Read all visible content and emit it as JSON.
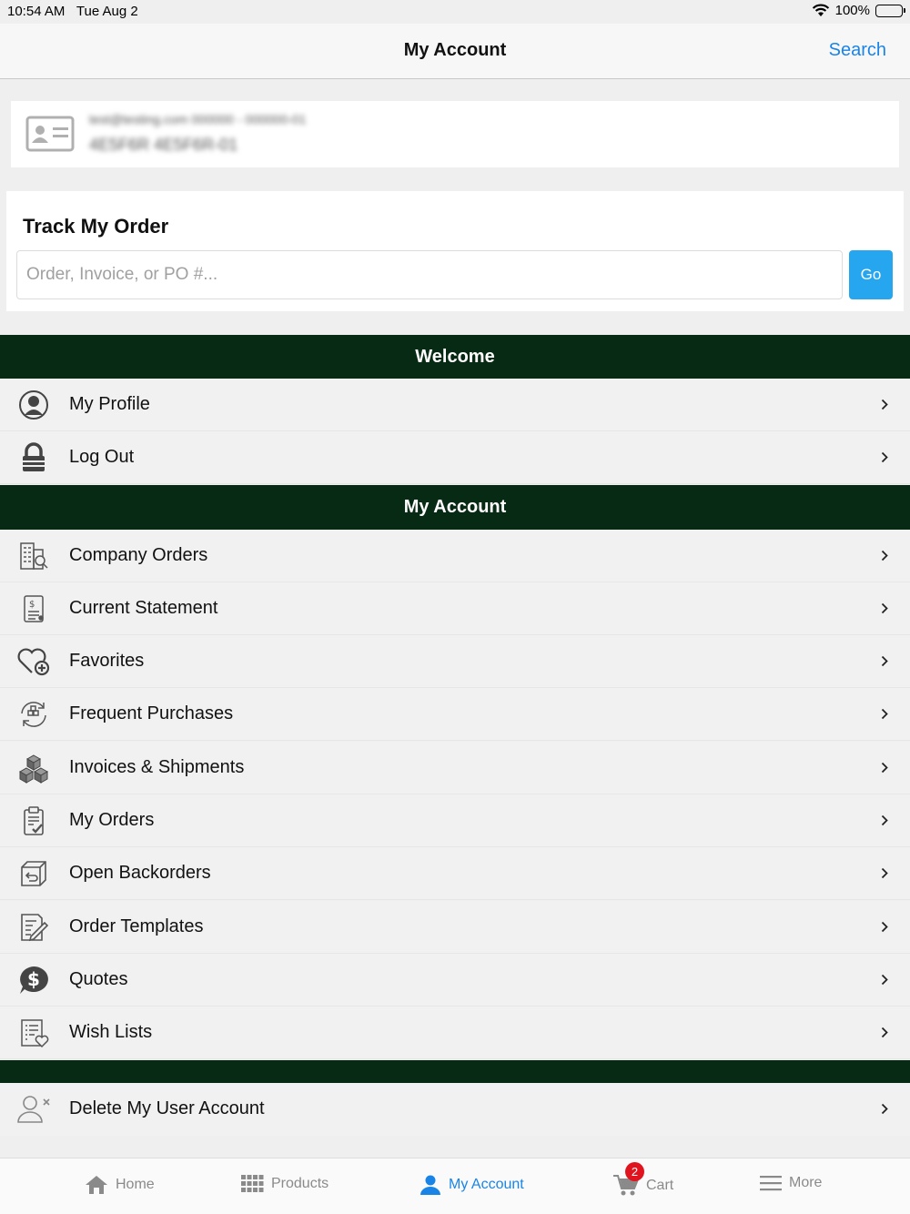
{
  "status_bar": {
    "time": "10:54 AM",
    "date": "Tue Aug 2",
    "battery": "100%"
  },
  "nav": {
    "title": "My Account",
    "search_label": "Search"
  },
  "account_card": {
    "line1": "test@testing.com  000000 - 000000-01",
    "line2": "4E5F6R   4E5F6R-01"
  },
  "track": {
    "heading": "Track My Order",
    "placeholder": "Order, Invoice, or PO #...",
    "go_label": "Go"
  },
  "welcome_section": {
    "title": "Welcome",
    "items": [
      {
        "label": "My Profile",
        "icon": "profile-icon"
      },
      {
        "label": "Log Out",
        "icon": "lock-icon"
      }
    ]
  },
  "account_section": {
    "title": "My Account",
    "items": [
      {
        "label": "Company Orders",
        "icon": "company-orders-icon"
      },
      {
        "label": "Current Statement",
        "icon": "statement-icon"
      },
      {
        "label": "Favorites",
        "icon": "heart-plus-icon"
      },
      {
        "label": "Frequent Purchases",
        "icon": "frequent-purchases-icon"
      },
      {
        "label": "Invoices & Shipments",
        "icon": "boxes-icon"
      },
      {
        "label": "My Orders",
        "icon": "clipboard-check-icon"
      },
      {
        "label": "Open Backorders",
        "icon": "backorder-box-icon"
      },
      {
        "label": "Order Templates",
        "icon": "template-edit-icon"
      },
      {
        "label": "Quotes",
        "icon": "dollar-bubble-icon"
      },
      {
        "label": "Wish Lists",
        "icon": "wishlist-icon"
      }
    ]
  },
  "delete_item": {
    "label": "Delete My User Account",
    "icon": "delete-user-icon"
  },
  "tabs": [
    {
      "label": "Home",
      "icon": "home-icon"
    },
    {
      "label": "Products",
      "icon": "grid-icon"
    },
    {
      "label": "My Account",
      "icon": "person-icon",
      "active": true
    },
    {
      "label": "Cart",
      "icon": "cart-icon",
      "badge": "2"
    },
    {
      "label": "More",
      "icon": "menu-icon"
    }
  ],
  "colors": {
    "header_green": "#072a14",
    "accent_blue": "#1a84e6",
    "go_button": "#27a6f0",
    "badge_red": "#e0141e"
  }
}
